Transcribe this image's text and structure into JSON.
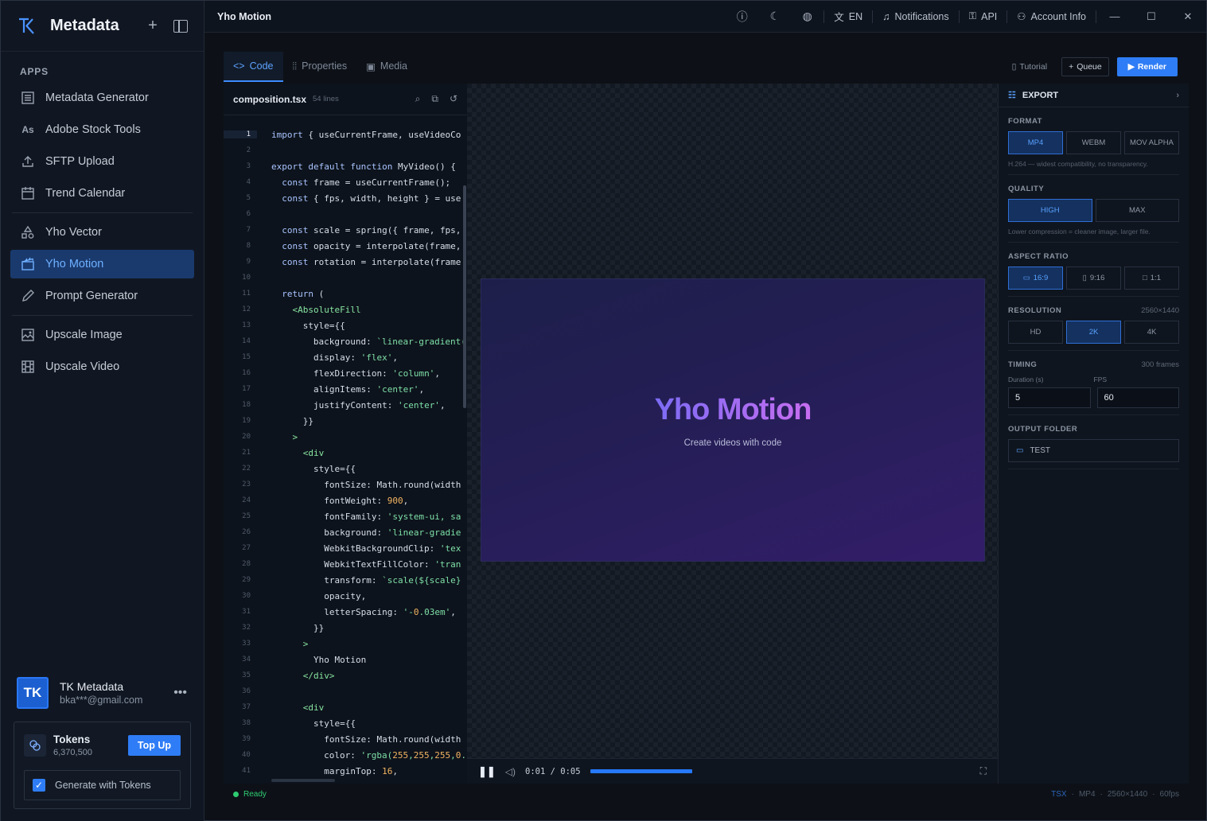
{
  "sidebar": {
    "brand": "Metadata",
    "section": "APPS",
    "items": [
      {
        "label": "Metadata Generator",
        "icon": "list-icon"
      },
      {
        "label": "Adobe Stock Tools",
        "icon": "adobe-stock-icon"
      },
      {
        "label": "SFTP Upload",
        "icon": "upload-icon"
      },
      {
        "label": "Trend Calendar",
        "icon": "calendar-icon"
      },
      {
        "label": "Yho Vector",
        "icon": "shapes-icon"
      },
      {
        "label": "Yho Motion",
        "icon": "clapperboard-icon",
        "active": true
      },
      {
        "label": "Prompt Generator",
        "icon": "pen-icon"
      },
      {
        "label": "Upscale Image",
        "icon": "image-upscale-icon"
      },
      {
        "label": "Upscale Video",
        "icon": "film-icon"
      }
    ],
    "user": {
      "initials": "TK",
      "name": "TK Metadata",
      "email": "bka***@gmail.com"
    },
    "tokens": {
      "label": "Tokens",
      "value": "6,370,500",
      "topup": "Top Up",
      "generate": "Generate with Tokens",
      "generate_checked": true
    }
  },
  "topbar": {
    "title": "Yho Motion",
    "lang": "EN",
    "notifications": "Notifications",
    "api": "API",
    "account": "Account Info"
  },
  "tabs": [
    {
      "label": "Code",
      "active": true
    },
    {
      "label": "Properties"
    },
    {
      "label": "Media"
    }
  ],
  "actions": {
    "tutorial": "Tutorial",
    "queue": "Queue",
    "render": "Render"
  },
  "editor": {
    "file": "composition.tsx",
    "lines_label": "54 lines",
    "current_line": 1,
    "code": [
      "import { useCurrentFrame, useVideoCo",
      "",
      "export default function MyVideo() {",
      "  const frame = useCurrentFrame();",
      "  const { fps, width, height } = use",
      "",
      "  const scale = spring({ frame, fps,",
      "  const opacity = interpolate(frame,",
      "  const rotation = interpolate(frame",
      "",
      "  return (",
      "    <AbsoluteFill",
      "      style={{",
      "        background: `linear-gradient(",
      "        display: 'flex',",
      "        flexDirection: 'column',",
      "        alignItems: 'center',",
      "        justifyContent: 'center',",
      "      }}",
      "    >",
      "      <div",
      "        style={{",
      "          fontSize: Math.round(width",
      "          fontWeight: 900,",
      "          fontFamily: 'system-ui, sa",
      "          background: 'linear-gradie",
      "          WebkitBackgroundClip: 'tex",
      "          WebkitTextFillColor: 'tran",
      "          transform: `scale(${scale}",
      "          opacity,",
      "          letterSpacing: '-0.03em',",
      "        }}",
      "      >",
      "        Yho Motion",
      "      </div>",
      "",
      "      <div",
      "        style={{",
      "          fontSize: Math.round(width",
      "          color: 'rgba(255,255,255,0.",
      "          marginTop: 16,"
    ]
  },
  "preview": {
    "title": "Yho Motion",
    "subtitle": "Create videos with code",
    "time": "0:01 / 0:05",
    "progress": 0.2
  },
  "export": {
    "header": "EXPORT",
    "format": {
      "label": "FORMAT",
      "options": [
        "MP4",
        "WEBM",
        "MOV ALPHA"
      ],
      "selected": 0,
      "hint": "H.264 — widest compatibility, no transparency."
    },
    "quality": {
      "label": "QUALITY",
      "options": [
        "HIGH",
        "MAX"
      ],
      "selected": 0,
      "hint": "Lower compression = cleaner image, larger file."
    },
    "aspect": {
      "label": "ASPECT RATIO",
      "options": [
        "16:9",
        "9:16",
        "1:1"
      ],
      "selected": 0
    },
    "resolution": {
      "label": "RESOLUTION",
      "value": "2560×1440",
      "options": [
        "HD",
        "2K",
        "4K"
      ],
      "selected": 1
    },
    "timing": {
      "label": "TIMING",
      "frames": "300 frames",
      "duration_label": "Duration (s)",
      "fps_label": "FPS",
      "duration": "5",
      "fps": "60"
    },
    "output": {
      "label": "OUTPUT FOLDER",
      "folder": "TEST"
    }
  },
  "status": {
    "state": "Ready",
    "meta": [
      "TSX",
      "MP4",
      "2560×1440",
      "60fps"
    ]
  },
  "colors": {
    "accent": "#2f7df6",
    "ready": "#2ecc71",
    "active_nav_bg": "#1a3a6e"
  }
}
